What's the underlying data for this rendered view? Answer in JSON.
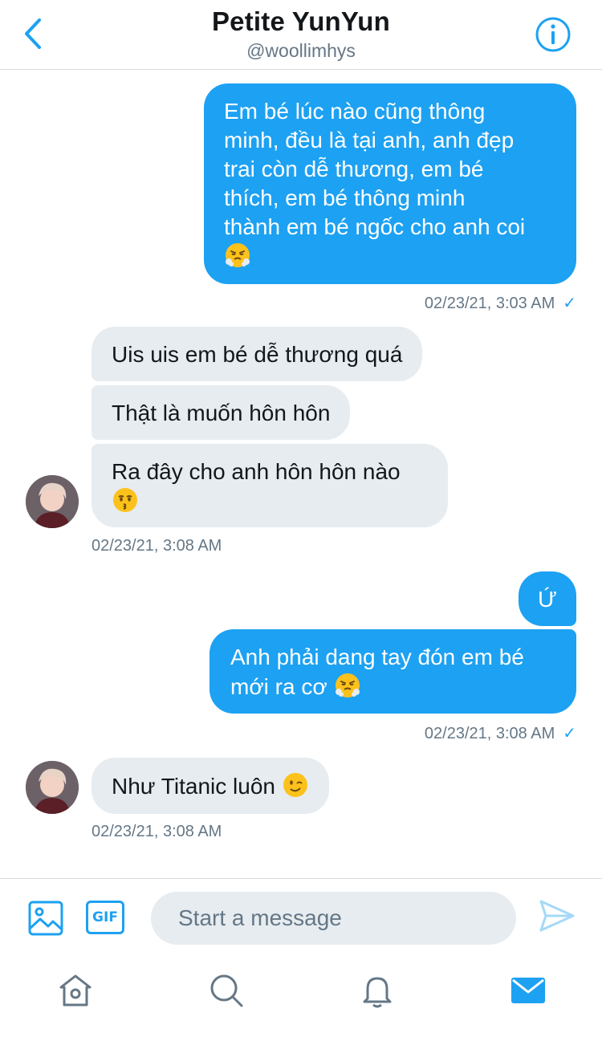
{
  "header": {
    "title": "Petite YunYun",
    "handle": "@woollimhys"
  },
  "messages": [
    {
      "id": "m1",
      "direction": "sent",
      "lines": [
        "Em bé lúc nào cũng thông",
        "minh, đều là tại anh, anh đẹp",
        "trai còn dễ thương, em bé",
        "thích, em bé thông minh",
        "thành em bé ngốc cho anh coi"
      ],
      "emoji": "triumph-face-emoji"
    },
    {
      "id": "m2",
      "direction": "received",
      "text": "Uis uis em bé dễ thương quá"
    },
    {
      "id": "m3",
      "direction": "received",
      "text": "Thật là muốn hôn hôn"
    },
    {
      "id": "m4",
      "direction": "received",
      "text": "Ra đây cho anh hôn hôn nào",
      "emoji": "kissing-face-emoji"
    },
    {
      "id": "m5",
      "direction": "sent",
      "text": "Ứ"
    },
    {
      "id": "m6",
      "direction": "sent",
      "lines": [
        "Anh phải dang tay đón em bé",
        "mới ra cơ"
      ],
      "emoji": "triumph-face-emoji"
    },
    {
      "id": "m7",
      "direction": "received",
      "text": "Như Titanic luôn",
      "emoji": "winking-face-emoji"
    }
  ],
  "timestamps": {
    "t1": "02/23/21, 3:03 AM",
    "t2": "02/23/21, 3:08 AM",
    "t3": "02/23/21, 3:08 AM",
    "t4": "02/23/21, 3:08 AM"
  },
  "composer": {
    "gif_label": "GIF",
    "placeholder": "Start a message"
  },
  "icons": {
    "back": "chevron-left-icon",
    "info": "info-icon",
    "media": "image-icon",
    "send": "send-icon",
    "tabs": [
      "home-icon",
      "search-icon",
      "bell-icon",
      "mail-icon"
    ]
  },
  "colors": {
    "accent": "#1da1f2",
    "received_bubble": "#e6ecf0",
    "secondary_text": "#657786"
  }
}
